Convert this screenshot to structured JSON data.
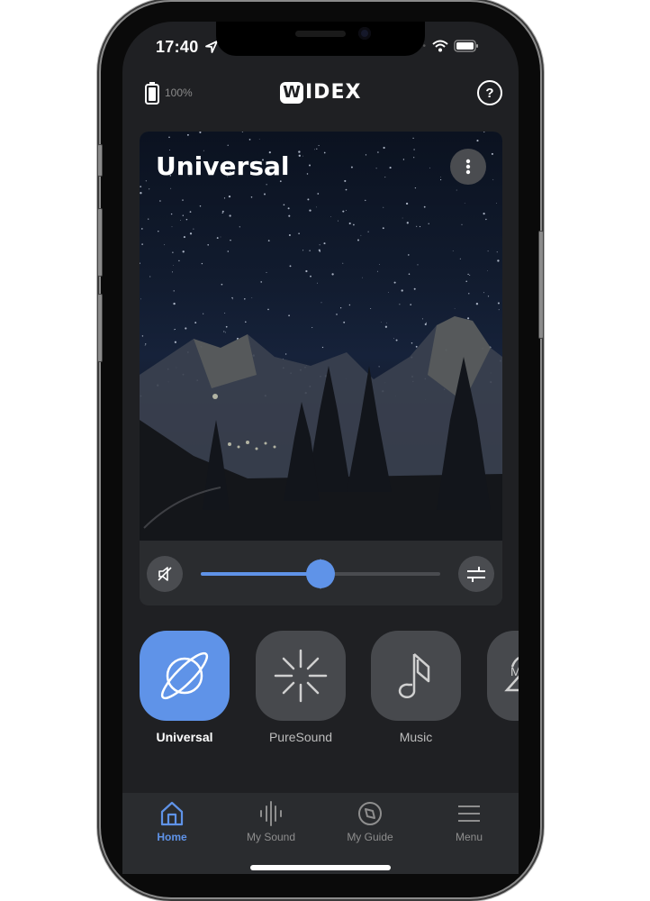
{
  "status_bar": {
    "time": "17:40",
    "icons": [
      "location-arrow-icon",
      "cellular-dots-icon",
      "wifi-icon",
      "battery-icon"
    ]
  },
  "header": {
    "device_battery_icon": "battery-icon",
    "device_battery_level": "100%",
    "logo_mark": "W",
    "logo_text": "IDEX",
    "help_icon": "question-circle-icon",
    "help_label": "?"
  },
  "program_card": {
    "title": "Universal",
    "more_icon": "vertical-ellipsis-icon",
    "image_description": "night sky over mountains with pine trees",
    "mute_icon": "speaker-muted-icon",
    "adjust_icon": "sliders-icon",
    "volume_fraction": 0.5
  },
  "programs": [
    {
      "label": "Universal",
      "icon": "planet-icon",
      "active": true
    },
    {
      "label": "PureSound",
      "icon": "starburst-icon",
      "active": false
    },
    {
      "label": "Music",
      "icon": "music-note-icon",
      "active": false
    },
    {
      "label": "",
      "icon": "partial-program-icon",
      "active": false
    }
  ],
  "tabbar": {
    "tabs": [
      {
        "label": "Home",
        "icon": "home-icon",
        "active": true
      },
      {
        "label": "My Sound",
        "icon": "sound-wave-icon",
        "active": false
      },
      {
        "label": "My Guide",
        "icon": "compass-icon",
        "active": false
      },
      {
        "label": "Menu",
        "icon": "hamburger-menu-icon",
        "active": false
      }
    ]
  },
  "colors": {
    "accent": "#5f93e8",
    "background": "#1f2023",
    "surface": "#2a2c2f",
    "tile": "#47494d"
  }
}
